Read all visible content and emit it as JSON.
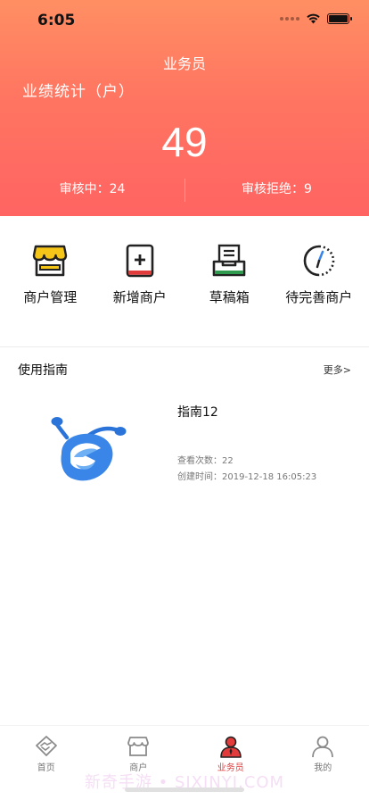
{
  "status_bar": {
    "time": "6:05"
  },
  "header": {
    "title": "业务员",
    "subtitle": "业绩统计（户）",
    "count": "49",
    "stats": [
      {
        "label": "审核中：24"
      },
      {
        "label": "审核拒绝：9"
      }
    ]
  },
  "quick_menu": {
    "items": [
      {
        "label": "商户管理",
        "icon": "store-icon"
      },
      {
        "label": "新增商户",
        "icon": "add-merchant-icon"
      },
      {
        "label": "草稿箱",
        "icon": "drafts-icon"
      },
      {
        "label": "待完善商户",
        "icon": "clock-icon"
      }
    ]
  },
  "guide": {
    "title": "使用指南",
    "more": "更多>",
    "items": [
      {
        "name": "指南12",
        "views": "查看次数：22",
        "created": "创建时间：2019-12-18 16:05:23"
      }
    ]
  },
  "tab_bar": {
    "tabs": [
      {
        "label": "首页",
        "icon": "handshake-icon",
        "active": false
      },
      {
        "label": "商户",
        "icon": "shop-icon",
        "active": false
      },
      {
        "label": "业务员",
        "icon": "salesperson-icon",
        "active": true
      },
      {
        "label": "我的",
        "icon": "profile-icon",
        "active": false
      }
    ]
  },
  "watermark": "新奇手游 • SIXINYI.COM",
  "colors": {
    "header_top": "#ff8f63",
    "header_bottom": "#ff6462",
    "accent_red": "#e13b3b",
    "accent_yellow": "#f5c518",
    "accent_green": "#2e9b4f",
    "logo_blue": "#3a86e8"
  }
}
